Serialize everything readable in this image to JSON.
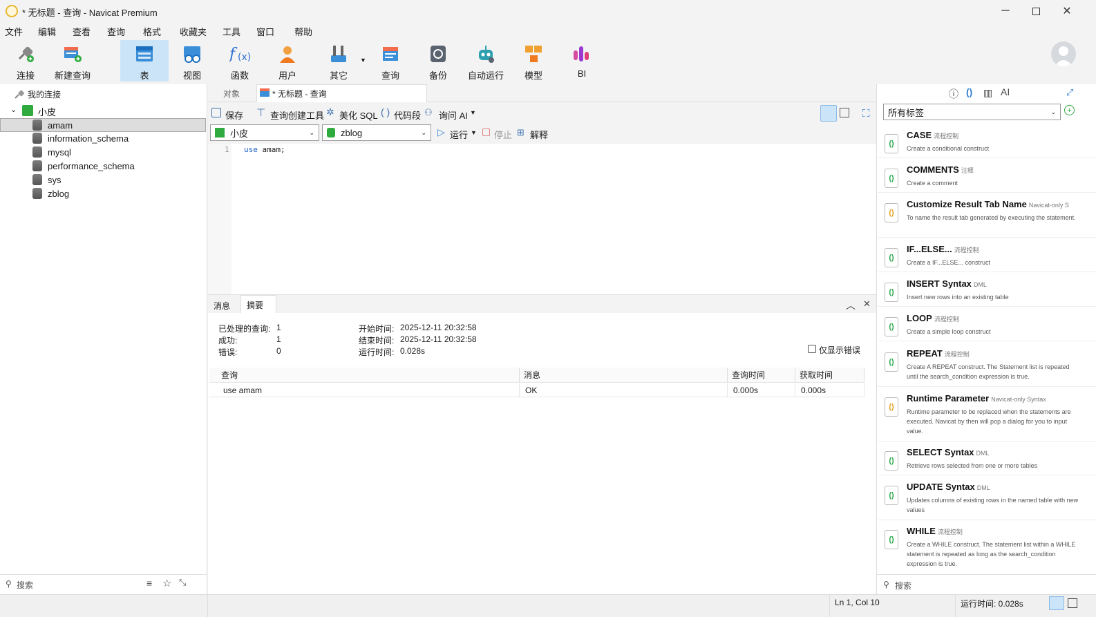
{
  "window": {
    "title": "* 无标题 - 查询 - Navicat Premium"
  },
  "menu": [
    "文件",
    "编辑",
    "查看",
    "查询",
    "格式",
    "收藏夹",
    "工具",
    "窗口",
    "帮助"
  ],
  "toolbar": [
    {
      "label": "连接",
      "icon": "plug-icon"
    },
    {
      "label": "新建查询",
      "icon": "new-query-icon"
    },
    {
      "label": "表",
      "icon": "table-icon"
    },
    {
      "label": "视图",
      "icon": "view-icon"
    },
    {
      "label": "函数",
      "icon": "function-icon"
    },
    {
      "label": "用户",
      "icon": "user-icon"
    },
    {
      "label": "其它",
      "icon": "tools-icon"
    },
    {
      "label": "查询",
      "icon": "query-icon"
    },
    {
      "label": "备份",
      "icon": "backup-icon"
    },
    {
      "label": "自动运行",
      "icon": "robot-icon"
    },
    {
      "label": "模型",
      "icon": "model-icon"
    },
    {
      "label": "BI",
      "icon": "bi-icon"
    }
  ],
  "nav": {
    "header": "我的连接",
    "connection": "小皮",
    "databases": [
      "amam",
      "information_schema",
      "mysql",
      "performance_schema",
      "sys",
      "zblog"
    ],
    "selected": "amam",
    "search_placeholder": "搜索"
  },
  "tabs": {
    "objects": "对象",
    "query": "* 无标题 - 查询"
  },
  "query_toolbar": {
    "save": "保存",
    "builder": "查询创建工具",
    "beautify": "美化 SQL",
    "snippet": "代码段",
    "ask_ai": "询问 AI"
  },
  "selectors": {
    "connection": "小皮",
    "database": "zblog",
    "run": "运行",
    "stop": "停止",
    "explain": "解释"
  },
  "editor": {
    "line": "1",
    "kw": "use",
    "rest": " amam;"
  },
  "result": {
    "tabs": [
      "消息",
      "摘要"
    ],
    "processed_label": "已处理的查询:",
    "processed": "1",
    "success_label": "成功:",
    "success": "1",
    "error_label": "错误:",
    "errors": "0",
    "start_label": "开始时间:",
    "start": "2025-12-11 20:32:58",
    "end_label": "结束时间:",
    "end": "2025-12-11 20:32:58",
    "elapsed_label": "运行时间:",
    "elapsed": "0.028s",
    "only_errors": "仅显示错误",
    "columns": [
      "查询",
      "消息",
      "查询时间",
      "获取时间"
    ],
    "rows": [
      [
        "use amam",
        "OK",
        "0.000s",
        "0.000s"
      ]
    ]
  },
  "snippets": {
    "filter": "所有标签",
    "search_placeholder": "搜索",
    "items": [
      {
        "name": "CASE",
        "tag": "流程控制",
        "desc": "Create a conditional construct"
      },
      {
        "name": "COMMENTS",
        "tag": "注释",
        "desc": "Create a comment"
      },
      {
        "name": "Customize Result Tab Name",
        "tag": "Navicat-only S",
        "desc": "To name the result tab generated by executing the statement."
      },
      {
        "name": "IF...ELSE...",
        "tag": "流程控制",
        "desc": "Create a IF...ELSE... construct"
      },
      {
        "name": "INSERT Syntax",
        "tag": "DML",
        "desc": "Insert new rows into an existing table"
      },
      {
        "name": "LOOP",
        "tag": "流程控制",
        "desc": "Create a simple loop construct"
      },
      {
        "name": "REPEAT",
        "tag": "流程控制",
        "desc": "Create A REPEAT construct. The Statement list is repeated until the search_condition expression is true."
      },
      {
        "name": "Runtime Parameter",
        "tag": "Navicat-only Syntax",
        "desc": "Runtime parameter to be replaced when the statements are executed. Navicat by then will pop a dialog for you to input value."
      },
      {
        "name": "SELECT Syntax",
        "tag": "DML",
        "desc": "Retrieve rows selected from one or more tables"
      },
      {
        "name": "UPDATE Syntax",
        "tag": "DML",
        "desc": "Updates columns of existing rows in the named table with new values"
      },
      {
        "name": "WHILE",
        "tag": "流程控制",
        "desc": "Create a WHILE construct. The statement list within a WHILE statement is repeated as long as the search_condition expression is true."
      }
    ]
  },
  "status": {
    "pos": "Ln 1, Col 10",
    "elapsed": "运行时间: 0.028s"
  }
}
